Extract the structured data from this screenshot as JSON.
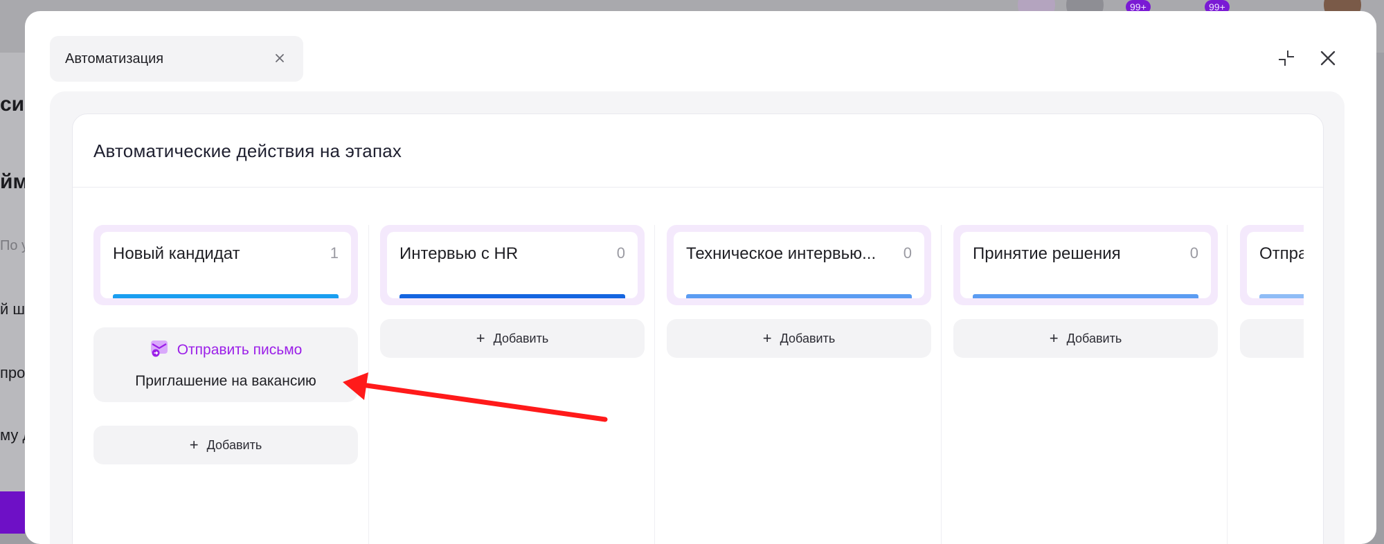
{
  "background": {
    "fragments": [
      "си",
      "йму",
      "По у",
      "й ш",
      "про",
      "му д"
    ],
    "badges": [
      "99+",
      "99+"
    ]
  },
  "modal": {
    "tab_label": "Автоматизация",
    "title": "Автоматические действия на этапах"
  },
  "add_label": "Добавить",
  "stages": [
    {
      "name": "Новый кандидат",
      "count": "1",
      "bar_color": "#1a9ef0"
    },
    {
      "name": "Интервью с HR",
      "count": "0",
      "bar_color": "#1565e0"
    },
    {
      "name": "Техническое интервью...",
      "count": "0",
      "bar_color": "#5b9cf2"
    },
    {
      "name": "Принятие решения",
      "count": "0",
      "bar_color": "#5b9cf2"
    },
    {
      "name": "Отпра",
      "count": "",
      "bar_color": "#8fbcf6"
    }
  ],
  "action": {
    "title": "Отправить письмо",
    "subtitle": "Приглашение на вакансию",
    "icon": "mail-send-icon",
    "accent": "#9b1fe8"
  },
  "annotation_color": "#ff1a1a"
}
